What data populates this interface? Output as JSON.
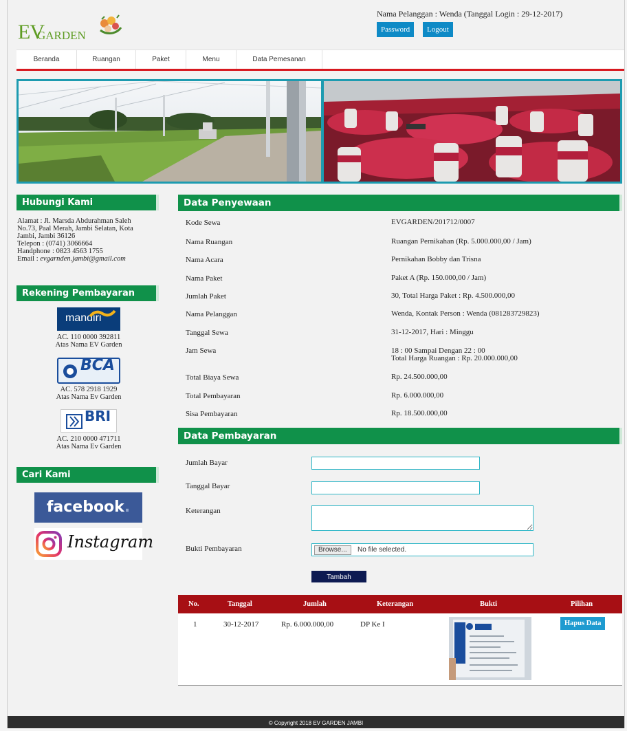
{
  "brand": {
    "logo_text_ev": "EV",
    "logo_text_garden": "GARDEN"
  },
  "header": {
    "user_info": "Nama Pelanggan : Wenda (Tanggal Login : 29-12-2017)",
    "password_label": "Password",
    "logout_label": "Logout"
  },
  "nav": {
    "items": [
      "Beranda",
      "Ruangan",
      "Paket",
      "Menu",
      "Data Pemesanan"
    ]
  },
  "sidebar": {
    "contact_title": "Hubungi Kami",
    "contact_lines": [
      "Alamat : Jl. Marsda Abdurahman Saleh",
      "No.73, Paal Merah, Jambi Selatan, Kota",
      "Jambi, Jambi 36126",
      "Telepon : (0741) 3066664",
      "Handphone : 0823 4563 1755"
    ],
    "email_label": "Email : ",
    "email_value": "evgarnden.jambi@gmail.com",
    "payment_title": "Rekening Pembayaran",
    "banks": [
      {
        "logo": "mandiri",
        "account": "AC. 110 0000 392811",
        "holder": "Atas Nama EV Garden"
      },
      {
        "logo": "BCA",
        "account": "AC. 578 2918 1929",
        "holder": "Atas Nama Ev Garden"
      },
      {
        "logo": "BRI",
        "account": "AC. 210 0000 471711",
        "holder": "Atas Nama Ev Garden"
      }
    ],
    "find_title": "Cari Kami",
    "facebook_label": "facebook",
    "instagram_label": "Instagram"
  },
  "rental": {
    "title": "Data Penyewaan",
    "rows": [
      {
        "label": "Kode Sewa",
        "value": "EVGARDEN/201712/0007"
      },
      {
        "label": "Nama Ruangan",
        "value": "Ruangan Pernikahan (Rp. 5.000.000,00 / Jam)"
      },
      {
        "label": "Nama Acara",
        "value": "Pernikahan Bobby dan Trisna"
      },
      {
        "label": "Nama Paket",
        "value": "Paket A (Rp. 150.000,00 / Jam)"
      },
      {
        "label": "Jumlah Paket",
        "value": "30, Total Harga Paket : Rp. 4.500.000,00"
      },
      {
        "label": "Nama Pelanggan",
        "value": "Wenda, Kontak Person : Wenda (081283729823)"
      },
      {
        "label": "Tanggal Sewa",
        "value": "31-12-2017, Hari : Minggu"
      },
      {
        "label": "Jam Sewa",
        "value": "18 : 00 Sampai Dengan 22 : 00",
        "value2": "Total Harga Ruangan : Rp. 20.000.000,00"
      },
      {
        "label": "Total Biaya Sewa",
        "value": "Rp. 24.500.000,00"
      },
      {
        "label": "Total Pembayaran",
        "value": "Rp. 6.000.000,00"
      },
      {
        "label": "Sisa Pembayaran",
        "value": "Rp. 18.500.000,00"
      }
    ]
  },
  "payment": {
    "title": "Data Pembayaran",
    "amount_label": "Jumlah Bayar",
    "amount_value": "",
    "date_label": "Tanggal Bayar",
    "date_value": "",
    "note_label": "Keterangan",
    "note_value": "",
    "proof_label": "Bukti Pembayaran",
    "browse_label": "Browse...",
    "no_file_text": "No file selected.",
    "submit_label": "Tambah"
  },
  "history": {
    "columns": [
      "No.",
      "Tanggal",
      "Jumlah",
      "Keterangan",
      "Bukti",
      "Pilihan"
    ],
    "rows": [
      {
        "no": "1",
        "date": "30-12-2017",
        "amount": "Rp. 6.000.000,00",
        "note": "DP Ke I",
        "action": "Hapus Data"
      }
    ]
  },
  "footer": {
    "text": "© Copyright 2018 EV GARDEN JAMBI"
  },
  "colors": {
    "green": "#10914a",
    "red": "#a70f14",
    "blue": "#0e8ac6",
    "navy": "#0d1a52"
  }
}
